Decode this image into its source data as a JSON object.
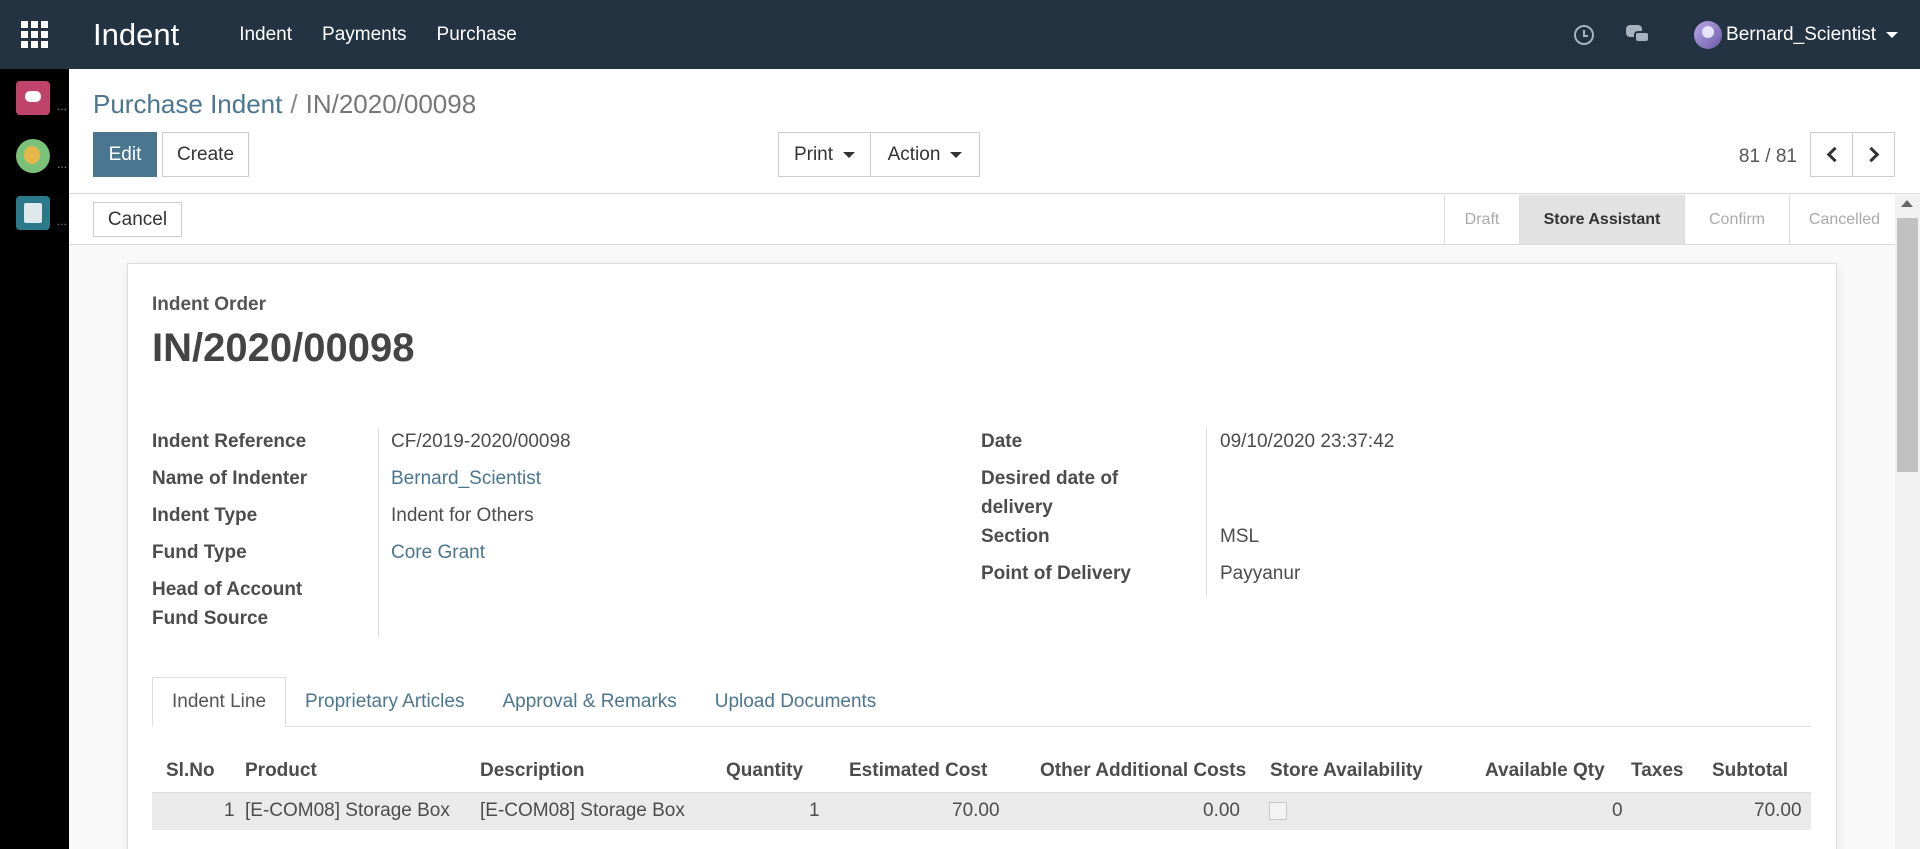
{
  "navbar": {
    "app_title": "Indent",
    "menu": [
      "Indent",
      "Payments",
      "Purchase"
    ],
    "user_name": "Bernard_Scientist"
  },
  "dock": {
    "dots": "..."
  },
  "breadcrumb": {
    "parent": "Purchase Indent",
    "separator": "/",
    "current": "IN/2020/00098"
  },
  "toolbar": {
    "edit_label": "Edit",
    "create_label": "Create",
    "print_label": "Print",
    "action_label": "Action"
  },
  "pager": {
    "value": "81 / 81"
  },
  "statusbar": {
    "cancel_label": "Cancel",
    "stages": [
      {
        "label": "Draft",
        "active": false
      },
      {
        "label": "Store Assistant",
        "active": true
      },
      {
        "label": "Confirm",
        "active": false
      },
      {
        "label": "Cancelled",
        "active": false
      }
    ]
  },
  "form": {
    "label": "Indent Order",
    "title": "IN/2020/00098",
    "left_fields": [
      {
        "label": "Indent Reference",
        "value": "CF/2019-2020/00098",
        "link": false
      },
      {
        "label": "Name of Indenter",
        "value": "Bernard_Scientist",
        "link": true
      },
      {
        "label": "Indent Type",
        "value": "Indent for Others",
        "link": false
      },
      {
        "label": "Fund Type",
        "value": "Core Grant",
        "link": true
      },
      {
        "label": "Head of Account",
        "value": "",
        "link": false
      },
      {
        "label": "Fund Source",
        "value": "",
        "link": false
      }
    ],
    "right_fields": [
      {
        "label": "Date",
        "value": "09/10/2020 23:37:42"
      },
      {
        "label": "Desired date of",
        "label2": "delivery",
        "value": ""
      },
      {
        "label": "Section",
        "value": "MSL"
      },
      {
        "label": "Point of Delivery",
        "value": "Payyanur"
      }
    ]
  },
  "tabs": [
    "Indent Line",
    "Proprietary Articles",
    "Approval & Remarks",
    "Upload Documents"
  ],
  "table": {
    "columns": [
      "Sl.No",
      "Product",
      "Description",
      "Quantity",
      "Estimated Cost",
      "Other Additional Costs",
      "Store Availability",
      "Available Qty",
      "Taxes",
      "Subtotal"
    ],
    "rows": [
      {
        "slno": "1",
        "product": "[E-COM08] Storage Box",
        "description": "[E-COM08] Storage Box",
        "quantity": "1",
        "estimated_cost": "70.00",
        "other_costs": "0.00",
        "store_availability": false,
        "available_qty": "0",
        "taxes": "",
        "subtotal": "70.00"
      }
    ]
  },
  "colors": {
    "navbar": "#243342",
    "accent": "#4b7690",
    "dock": "#000000"
  }
}
